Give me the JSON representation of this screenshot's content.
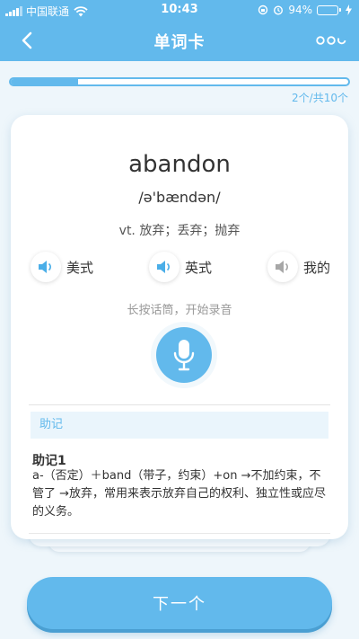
{
  "status_bar": {
    "carrier": "中国联通",
    "time": "10:43",
    "battery_percent": "94%",
    "battery_level": 0.94
  },
  "nav": {
    "title": "单词卡",
    "back_icon": "chevron-left-icon",
    "more_icon": "more-icon"
  },
  "progress": {
    "current": 2,
    "total": 10,
    "fraction": 0.2,
    "label": "2个/共10个"
  },
  "card": {
    "word": "abandon",
    "phonetic": "/ə'bændən/",
    "meaning": "vt. 放弃；丢弃；抛弃",
    "speakers": [
      {
        "label": "美式",
        "icon": "speaker-icon",
        "active": true
      },
      {
        "label": "英式",
        "icon": "speaker-icon",
        "active": true
      },
      {
        "label": "我的",
        "icon": "speaker-icon",
        "active": false
      }
    ],
    "record_hint": "长按话筒，开始录音",
    "mnemonic_header": "助记",
    "mnemonic_title": "助记1",
    "mnemonic_text": "a-（否定）＋band（带子，约束）+on →不加约束，不管了 →放弃，常用来表示放弃自己的权利、独立性或应尽的义务。"
  },
  "next_button": {
    "label": "下一个"
  },
  "colors": {
    "primary": "#62b9ec",
    "speaker_active": "#4aaee8",
    "speaker_inactive": "#a7a7a7"
  }
}
